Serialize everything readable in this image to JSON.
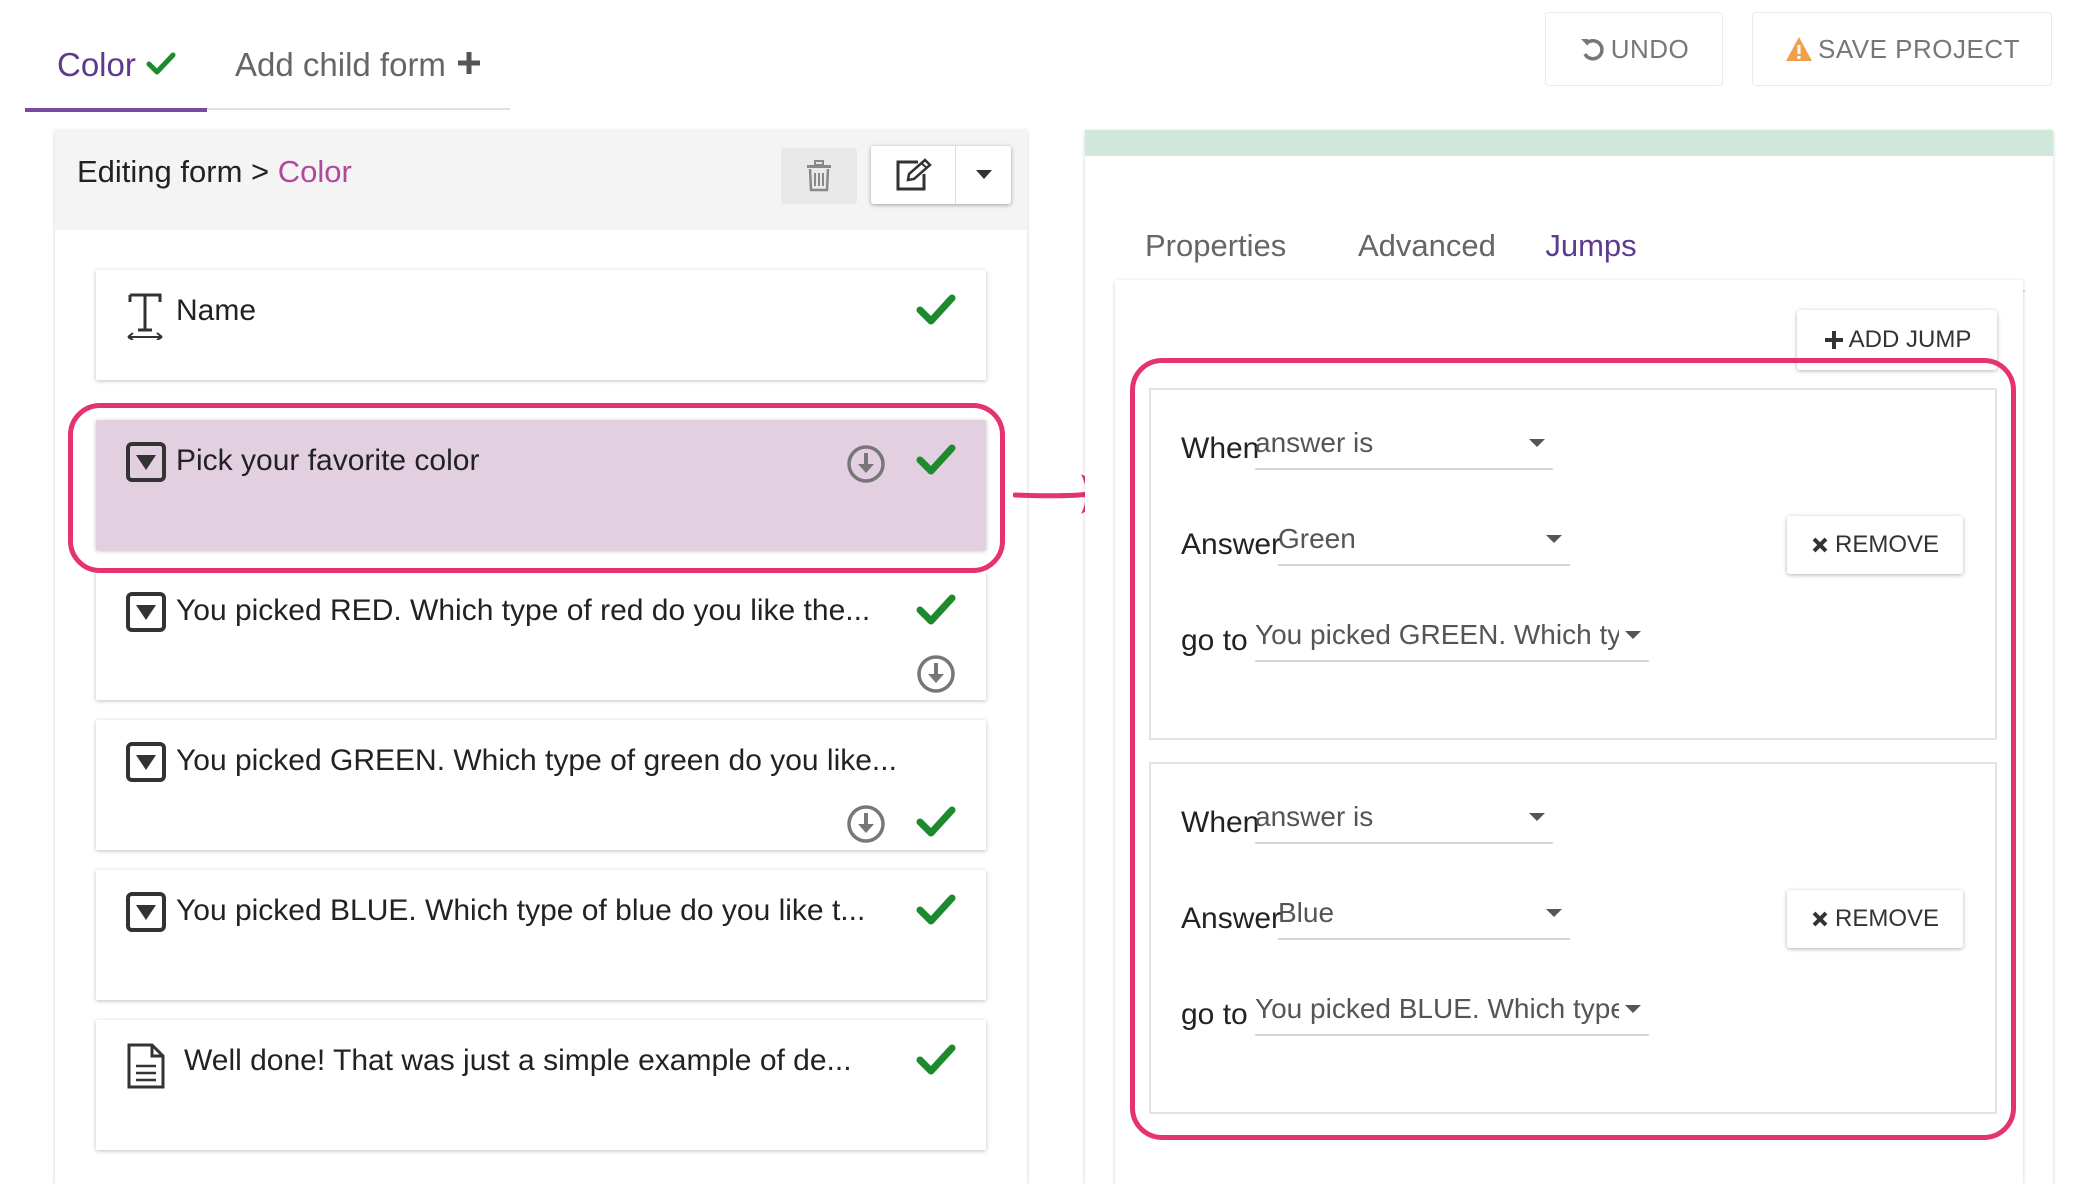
{
  "top_tabs": {
    "color": "Color",
    "add_child": "Add child form"
  },
  "toolbar": {
    "undo": "UNDO",
    "save": "SAVE PROJECT"
  },
  "editing": {
    "prefix": "Editing form > ",
    "form_name": "Color"
  },
  "questions": [
    {
      "icon": "text-type-icon",
      "label": "Name"
    },
    {
      "icon": "dropdown-question-icon",
      "label": "Pick your favorite color"
    },
    {
      "icon": "dropdown-question-icon",
      "label": "You picked RED. Which type of red do you like the..."
    },
    {
      "icon": "dropdown-question-icon",
      "label": "You picked GREEN. Which type of green do you like..."
    },
    {
      "icon": "dropdown-question-icon",
      "label": "You picked BLUE. Which type of blue do you like t..."
    },
    {
      "icon": "document-icon",
      "label": "Well done! That was just a simple example of de..."
    }
  ],
  "right_tabs": {
    "properties": "Properties",
    "advanced": "Advanced",
    "jumps": "Jumps"
  },
  "add_jump": "ADD JUMP",
  "jump_labels": {
    "when": "When",
    "answer": "Answer",
    "go_to": "go to",
    "remove": "REMOVE"
  },
  "jumps": [
    {
      "when": "answer is",
      "answer": "Green",
      "go_to": "You picked GREEN. Which type"
    },
    {
      "when": "answer is",
      "answer": "Blue",
      "go_to": "You picked BLUE. Which type"
    }
  ],
  "colors": {
    "accent_purple": "#7a4a9e",
    "form_name_pink": "#b3479c",
    "highlight": "#e4336e",
    "check_green": "#1e8a2e",
    "selected_bg": "#e2cfe0",
    "warning": "#f0a04b"
  }
}
